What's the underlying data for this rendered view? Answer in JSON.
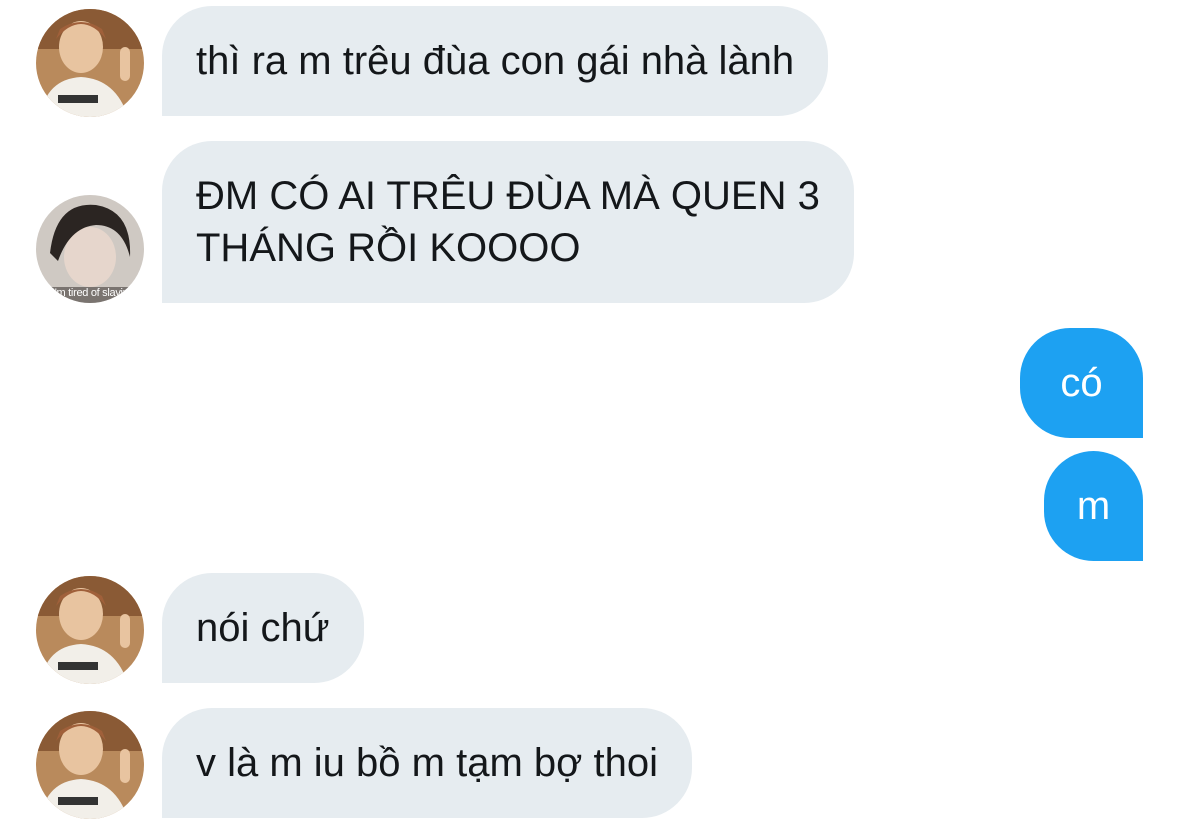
{
  "conversation": {
    "messages": [
      {
        "sender": "other",
        "avatar": "avatar-a",
        "text": "thì ra m trêu đùa con gái nhà lành"
      },
      {
        "sender": "other",
        "avatar": "avatar-b",
        "text": "ĐM CÓ AI TRÊU ĐÙA MÀ QUEN 3\nTHÁNG RỒI KOOOO"
      },
      {
        "sender": "me",
        "text": "có"
      },
      {
        "sender": "me",
        "text": "m"
      },
      {
        "sender": "other",
        "avatar": "avatar-a",
        "text": "nói chứ"
      },
      {
        "sender": "other",
        "avatar": "avatar-a",
        "text": "v là m iu bồ m tạm bợ thoi"
      }
    ],
    "avatar_b_caption": "I'm tired of slaving"
  },
  "colors": {
    "incoming_bubble": "#e6ecf0",
    "outgoing_bubble": "#1da1f2",
    "incoming_text": "#14171a",
    "outgoing_text": "#ffffff"
  }
}
